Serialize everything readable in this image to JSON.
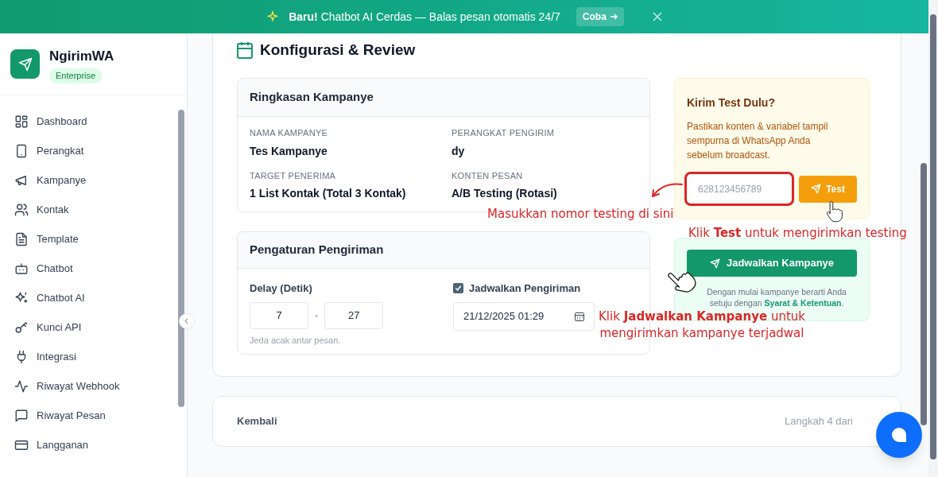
{
  "banner": {
    "text": "**Baru!** Chatbot AI Cerdas — Balas pesan otomatis 24/7",
    "button": "Coba"
  },
  "sidebar": {
    "brand": "NgirimWA",
    "plan": "Enterprise",
    "items": [
      {
        "label": "Dashboard"
      },
      {
        "label": "Perangkat"
      },
      {
        "label": "Kampanye"
      },
      {
        "label": "Kontak"
      },
      {
        "label": "Template"
      },
      {
        "label": "Chatbot"
      },
      {
        "label": "Chatbot AI"
      },
      {
        "label": "Kunci API"
      },
      {
        "label": "Integrasi"
      },
      {
        "label": "Riwayat Webhook"
      },
      {
        "label": "Riwayat Pesan"
      },
      {
        "label": "Langganan"
      }
    ]
  },
  "page_title": "Konfigurasi & Review",
  "summary": {
    "title": "Ringkasan Kampanye",
    "fields": [
      {
        "label": "NAMA KAMPANYE",
        "value": "Tes Kampanye"
      },
      {
        "label": "PERANGKAT PENGIRIM",
        "value": "dy"
      },
      {
        "label": "TARGET PENERIMA",
        "value": "1 List Kontak (Total 3 Kontak)"
      },
      {
        "label": "KONTEN PESAN",
        "value": "A/B Testing (Rotasi)"
      }
    ]
  },
  "settings": {
    "title": "Pengaturan Pengiriman",
    "delay_label": "Delay (Detik)",
    "delay_min": "7",
    "separator": "-",
    "delay_max": "27",
    "delay_hint": "Jeda acak antar pesan.",
    "schedule_label": "Jadwalkan Pengiriman",
    "schedule_checked": true,
    "schedule_value": "21/12/2025 01:29"
  },
  "test_card": {
    "title": "Kirim Test Dulu?",
    "description": "Pastikan konten & variabel tampil sempurna di WhatsApp Anda sebelum broadcast.",
    "placeholder": "628123456789",
    "button": "Test"
  },
  "launch_card": {
    "button": "Jadwalkan Kampanye",
    "terms_text": "Dengan mulai kampanye berarti Anda setuju dengan",
    "terms_link": "Syarat & Ketentuan",
    "terms_end": "."
  },
  "annotations": [
    {
      "text": "Masukkan nomor testing di sini"
    },
    {
      "text": "Klik **Test** untuk mengirimkan testing"
    },
    {
      "text": "Klik **Jadwalkan Kampanye** untuk mengirimkan kampanye terjadwal"
    }
  ],
  "footer": {
    "back": "Kembali",
    "step": "Langkah 4 dari"
  }
}
